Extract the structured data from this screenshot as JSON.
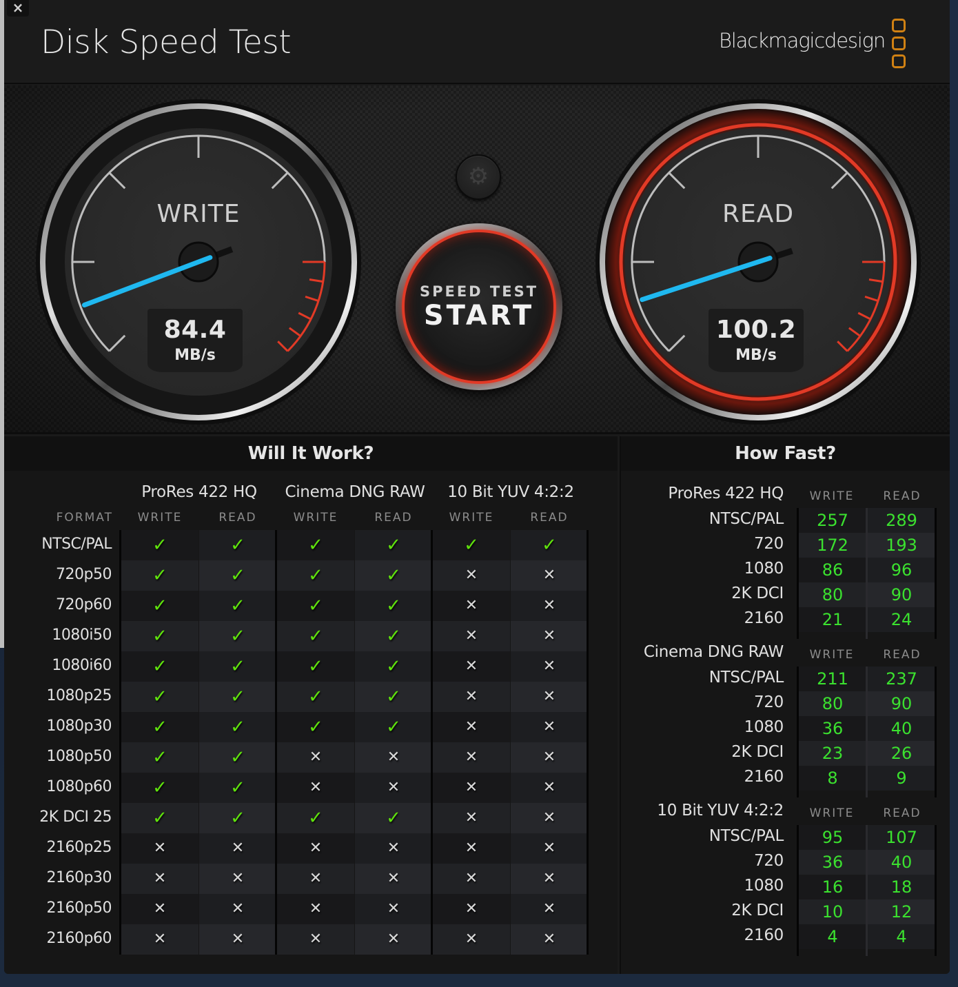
{
  "window": {
    "title": "Disk Speed Test",
    "brand": "Blackmagicdesign",
    "close_label": "×"
  },
  "gauges": {
    "write": {
      "label": "WRITE",
      "value": "84.4",
      "unit": "MB/s",
      "needle_fraction": 0.09
    },
    "read": {
      "label": "READ",
      "value": "100.2",
      "unit": "MB/s",
      "needle_fraction": 0.1,
      "active": true
    }
  },
  "controls": {
    "settings_icon": "gear-icon",
    "start_line1": "SPEED TEST",
    "start_line2": "START"
  },
  "colors": {
    "accent_red": "#e23a26",
    "needle_blue": "#1fb8f0",
    "check_green": "#5fe20c",
    "value_green": "#3be12f",
    "brand_orange": "#d08113"
  },
  "will_it_work": {
    "title": "Will It Work?",
    "format_header": "FORMAT",
    "codecs": [
      "ProRes 422 HQ",
      "Cinema DNG RAW",
      "10 Bit YUV 4:2:2"
    ],
    "sub_headers": [
      "WRITE",
      "READ",
      "WRITE",
      "READ",
      "WRITE",
      "READ"
    ],
    "rows": [
      {
        "format": "NTSC/PAL",
        "results": [
          1,
          1,
          1,
          1,
          1,
          1
        ]
      },
      {
        "format": "720p50",
        "results": [
          1,
          1,
          1,
          1,
          0,
          0
        ]
      },
      {
        "format": "720p60",
        "results": [
          1,
          1,
          1,
          1,
          0,
          0
        ]
      },
      {
        "format": "1080i50",
        "results": [
          1,
          1,
          1,
          1,
          0,
          0
        ]
      },
      {
        "format": "1080i60",
        "results": [
          1,
          1,
          1,
          1,
          0,
          0
        ]
      },
      {
        "format": "1080p25",
        "results": [
          1,
          1,
          1,
          1,
          0,
          0
        ]
      },
      {
        "format": "1080p30",
        "results": [
          1,
          1,
          1,
          1,
          0,
          0
        ]
      },
      {
        "format": "1080p50",
        "results": [
          1,
          1,
          0,
          0,
          0,
          0
        ]
      },
      {
        "format": "1080p60",
        "results": [
          1,
          1,
          0,
          0,
          0,
          0
        ]
      },
      {
        "format": "2K DCI 25",
        "results": [
          1,
          1,
          1,
          1,
          0,
          0
        ]
      },
      {
        "format": "2160p25",
        "results": [
          0,
          0,
          0,
          0,
          0,
          0
        ]
      },
      {
        "format": "2160p30",
        "results": [
          0,
          0,
          0,
          0,
          0,
          0
        ]
      },
      {
        "format": "2160p50",
        "results": [
          0,
          0,
          0,
          0,
          0,
          0
        ]
      },
      {
        "format": "2160p60",
        "results": [
          0,
          0,
          0,
          0,
          0,
          0
        ]
      }
    ],
    "check_glyph": "✓",
    "cross_glyph": "✕"
  },
  "how_fast": {
    "title": "How Fast?",
    "write_header": "WRITE",
    "read_header": "READ",
    "groups": [
      {
        "codec": "ProRes 422 HQ",
        "rows": [
          {
            "label": "NTSC/PAL",
            "write": "257",
            "read": "289"
          },
          {
            "label": "720",
            "write": "172",
            "read": "193"
          },
          {
            "label": "1080",
            "write": "86",
            "read": "96"
          },
          {
            "label": "2K DCI",
            "write": "80",
            "read": "90"
          },
          {
            "label": "2160",
            "write": "21",
            "read": "24"
          }
        ]
      },
      {
        "codec": "Cinema DNG RAW",
        "rows": [
          {
            "label": "NTSC/PAL",
            "write": "211",
            "read": "237"
          },
          {
            "label": "720",
            "write": "80",
            "read": "90"
          },
          {
            "label": "1080",
            "write": "36",
            "read": "40"
          },
          {
            "label": "2K DCI",
            "write": "23",
            "read": "26"
          },
          {
            "label": "2160",
            "write": "8",
            "read": "9"
          }
        ]
      },
      {
        "codec": "10 Bit YUV 4:2:2",
        "rows": [
          {
            "label": "NTSC/PAL",
            "write": "95",
            "read": "107"
          },
          {
            "label": "720",
            "write": "36",
            "read": "40"
          },
          {
            "label": "1080",
            "write": "16",
            "read": "18"
          },
          {
            "label": "2K DCI",
            "write": "10",
            "read": "12"
          },
          {
            "label": "2160",
            "write": "4",
            "read": "4"
          }
        ]
      }
    ]
  }
}
